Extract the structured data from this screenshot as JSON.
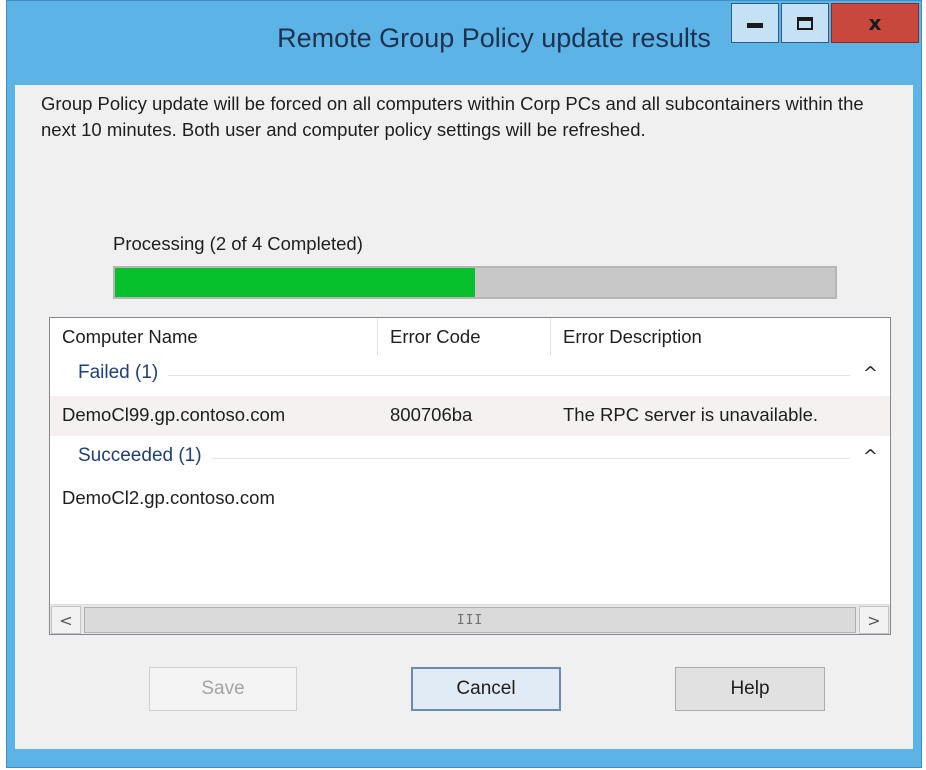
{
  "window": {
    "title": "Remote Group Policy update results",
    "controls": {
      "minimize": "minimize-icon",
      "maximize": "maximize-icon",
      "close": "close-icon"
    },
    "close_glyph": "x"
  },
  "intro": "Group Policy update will be forced on all computers within Corp PCs and all subcontainers within the next 10 minutes. Both user and computer policy settings will be refreshed.",
  "progress": {
    "label": "Processing (2 of 4 Completed)",
    "completed": 2,
    "total": 4,
    "fraction": 0.5,
    "fill_color": "#06c12b"
  },
  "list": {
    "columns": [
      "Computer Name",
      "Error Code",
      "Error Description"
    ],
    "groups": [
      {
        "label": "Failed (1)",
        "rows": [
          {
            "name": "DemoCl99.gp.contoso.com",
            "code": "800706ba",
            "description": "The RPC server is unavailable."
          }
        ]
      },
      {
        "label": "Succeeded (1)",
        "rows": [
          {
            "name": "DemoCl2.gp.contoso.com",
            "code": "",
            "description": ""
          }
        ]
      }
    ],
    "scrollbar": {
      "left_arrow": "<",
      "right_arrow": ">",
      "grip": "III"
    }
  },
  "buttons": {
    "save": "Save",
    "cancel": "Cancel",
    "help": "Help"
  },
  "colors": {
    "title_bar": "#5cb3e6",
    "close_button": "#c9483e",
    "group_text": "#1e3f78"
  }
}
